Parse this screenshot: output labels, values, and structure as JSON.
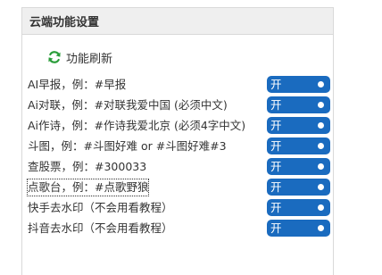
{
  "panel": {
    "title": "云端功能设置"
  },
  "refresh": {
    "label": "功能刷新",
    "icon": "refresh-icon",
    "icon_color": "#2a9d3a"
  },
  "toggle_color": "#1a6bbf",
  "features": [
    {
      "label": "AI早报，例：#早报",
      "state": "开"
    },
    {
      "label": "Ai对联，例：#对联我爱中国 (必须中文)",
      "state": "开"
    },
    {
      "label": "Ai作诗，例：#作诗我爱北京 (必须4字中文)",
      "state": "开"
    },
    {
      "label": "斗图，例：#斗图好难 or #斗图好难#3",
      "state": "开"
    },
    {
      "label": "查股票，例：#300033",
      "state": "开"
    },
    {
      "label": "点歌台，例：#点歌野狼",
      "state": "开"
    },
    {
      "label": "快手去水印（不会用看教程）",
      "state": "开"
    },
    {
      "label": "抖音去水印（不会用看教程）",
      "state": "开"
    }
  ]
}
